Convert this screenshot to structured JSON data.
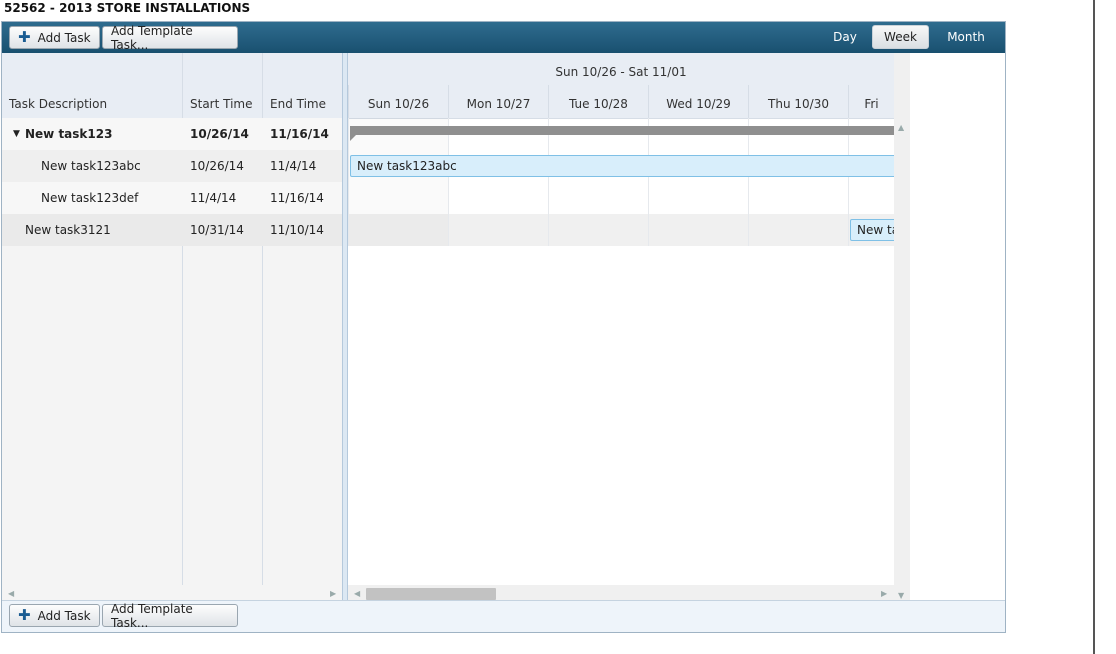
{
  "page_title": "52562 - 2013 STORE INSTALLATIONS",
  "toolbar": {
    "add_task": "Add Task",
    "add_template_task": "Add Template Task...",
    "views": [
      "Day",
      "Week",
      "Month"
    ],
    "active_view": "Week"
  },
  "grid": {
    "columns": [
      "Task Description",
      "Start Time",
      "End Time"
    ],
    "rows": [
      {
        "name": "New task123",
        "start": "10/26/14",
        "end": "11/16/14",
        "level": 0,
        "summary": true,
        "expanded": true
      },
      {
        "name": "New task123abc",
        "start": "10/26/14",
        "end": "11/4/14",
        "level": 1,
        "summary": false
      },
      {
        "name": "New task123def",
        "start": "11/4/14",
        "end": "11/16/14",
        "level": 1,
        "summary": false
      },
      {
        "name": "New task3121",
        "start": "10/31/14",
        "end": "11/10/14",
        "level": 0,
        "summary": false
      }
    ]
  },
  "timeline": {
    "week_label": "Sun 10/26 - Sat 11/01",
    "days": [
      "Sun 10/26",
      "Mon 10/27",
      "Tue 10/28",
      "Wed 10/29",
      "Thu 10/30",
      "Fri"
    ],
    "bars": {
      "task123abc": "New task123abc",
      "task3121": "New ta"
    }
  },
  "bottom_toolbar": {
    "add_task": "Add Task",
    "add_template_task": "Add Template Task..."
  },
  "colors": {
    "toolbar": "#1f5b7e",
    "task_bar": "#d8eefb",
    "summary_bar": "#8f8f8f"
  },
  "icons": [
    "plus-icon",
    "expand-triangle-icon",
    "scroll-arrow-icon"
  ]
}
